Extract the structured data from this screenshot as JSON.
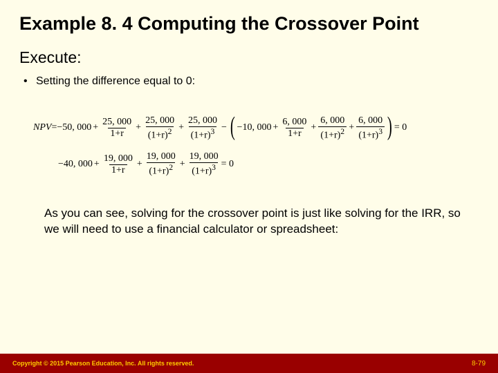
{
  "title": "Example 8. 4 Computing the Crossover Point",
  "subhead": "Execute:",
  "bullet1": "Setting the difference equal to 0:",
  "eq": {
    "npv_label": "NPV",
    "eq_sign": " = ",
    "lead1": "−50, 000",
    "plus": "+",
    "f1_num": "25, 000",
    "f1_den": "1+r",
    "f2_num": "25, 000",
    "f2_den_l": "(1+r)",
    "f2_den_e": "2",
    "f3_num": "25, 000",
    "f3_den_l": "(1+r)",
    "f3_den_e": "3",
    "minus": "−",
    "inner_lead": "−10, 000",
    "g1_num": "6, 000",
    "g1_den": "1+r",
    "g2_num": "6, 000",
    "g2_den_l": "(1+r)",
    "g2_den_e": "2",
    "g3_num": "6, 000",
    "g3_den_l": "(1+r)",
    "g3_den_e": "3",
    "tail1": " = 0",
    "lead2": "−40, 000",
    "h1_num": "19, 000",
    "h1_den": "1+r",
    "h2_num": "19, 000",
    "h2_den_l": "(1+r)",
    "h2_den_e": "2",
    "h3_num": "19, 000",
    "h3_den_l": "(1+r)",
    "h3_den_e": "3",
    "tail2": " = 0"
  },
  "body": "As you can see, solving for the crossover point is just like solving for the IRR, so we will need to use a financial calculator or spreadsheet:",
  "copyright": "Copyright © 2015 Pearson Education, Inc. All rights reserved.",
  "pagenum": "8-79"
}
